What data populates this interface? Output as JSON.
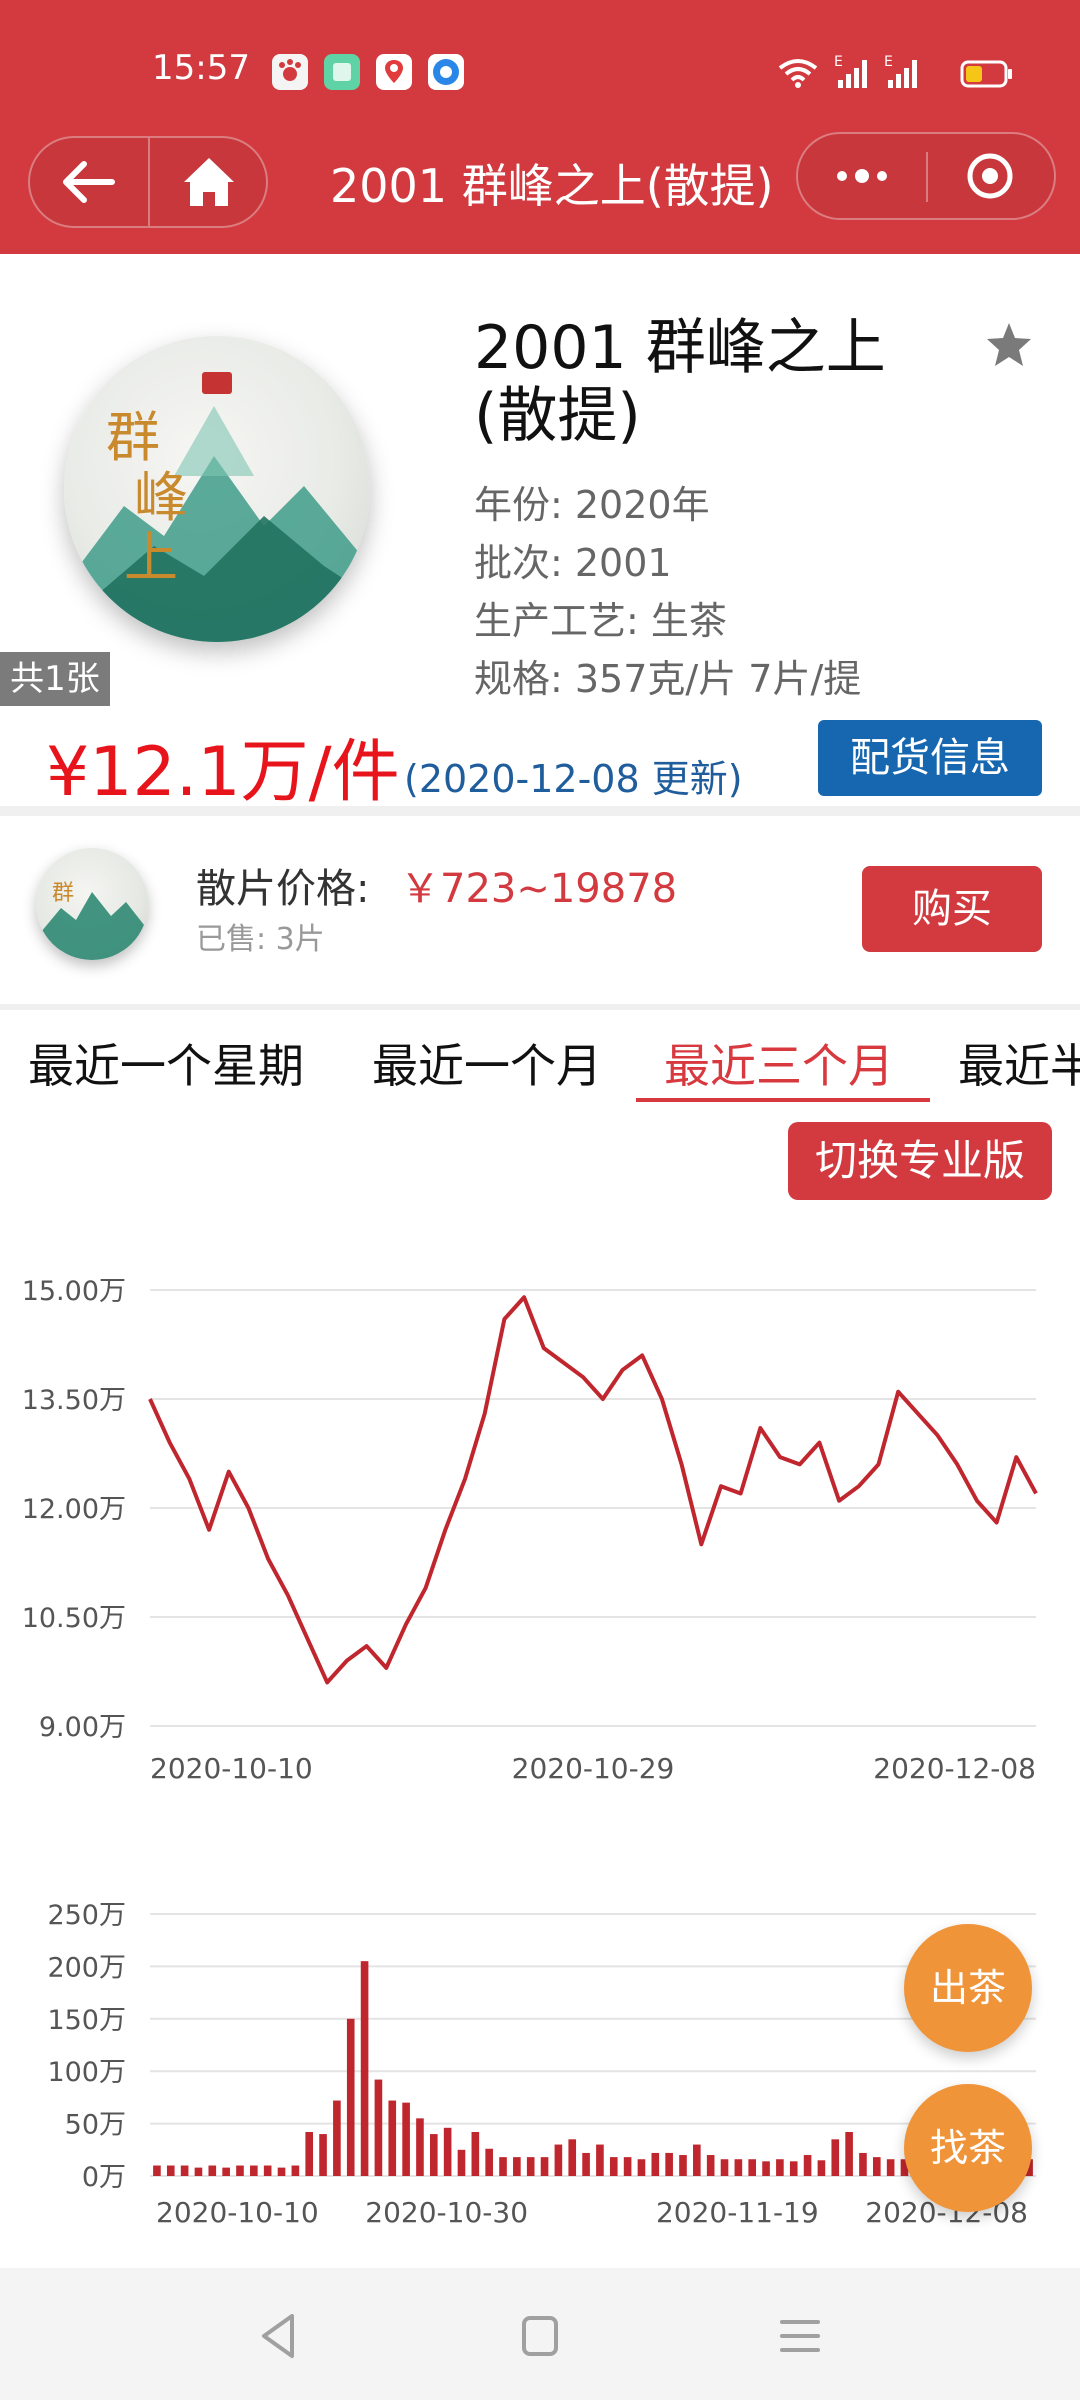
{
  "status_bar": {
    "time": "15:57",
    "app_icons": [
      "paw-app-icon",
      "green-app-icon",
      "map-app-icon",
      "blue-app-icon"
    ],
    "signal_labels": [
      "E",
      "E"
    ]
  },
  "nav": {
    "title": "2001 群峰之上(散提)"
  },
  "product": {
    "title": "2001 群峰之上(散提)",
    "image_count": "共1张",
    "year": "年份: 2020年",
    "batch": "批次: 2001",
    "process": "生产工艺: 生茶",
    "spec": "规格: 357克/片 7片/提",
    "price": "¥12.1万/件",
    "updated": "(2020-12-08 更新)",
    "allocation_button": "配货信息"
  },
  "loose": {
    "label": "散片价格:",
    "price": "￥723~19878",
    "sold": "已售: 3片",
    "buy_button": "购买"
  },
  "tabs": [
    "最近一个星期",
    "最近一个月",
    "最近三个月",
    "最近半"
  ],
  "active_tab": 2,
  "pro_button": "切换专业版",
  "fabs": {
    "sell": "出茶",
    "find": "找茶"
  },
  "colors": {
    "brand_red": "#d23a3f",
    "price_red": "#e8141b",
    "link_blue": "#1767b0",
    "orange": "#f0943a",
    "line": "#c0262d"
  },
  "chart_data": [
    {
      "type": "line",
      "y_tick_labels": [
        "15.00万",
        "13.50万",
        "12.00万",
        "10.50万",
        "9.00万"
      ],
      "x_tick_labels": [
        "2020-10-10",
        "2020-10-29",
        "2020-12-08"
      ],
      "ylim": [
        9.0,
        15.0
      ],
      "unit": "万",
      "grid": true,
      "values": [
        13.5,
        12.9,
        12.4,
        11.7,
        12.5,
        12.0,
        11.3,
        10.8,
        10.2,
        9.6,
        9.9,
        10.1,
        9.8,
        10.4,
        10.9,
        11.7,
        12.4,
        13.3,
        14.6,
        14.9,
        14.2,
        14.0,
        13.8,
        13.5,
        13.9,
        14.1,
        13.5,
        12.6,
        11.5,
        12.3,
        12.2,
        13.1,
        12.7,
        12.6,
        12.9,
        12.1,
        12.3,
        12.6,
        13.6,
        13.3,
        13.0,
        12.6,
        12.1,
        11.8,
        12.7,
        12.2
      ]
    },
    {
      "type": "bar",
      "y_tick_labels": [
        "250万",
        "200万",
        "150万",
        "100万",
        "50万",
        "0万"
      ],
      "x_tick_labels": [
        "2020-10-10",
        "2020-10-30",
        "2020-11-19",
        "2020-12-08"
      ],
      "ylim": [
        0,
        250
      ],
      "unit": "万",
      "grid": true,
      "values": [
        10,
        10,
        10,
        8,
        10,
        8,
        10,
        10,
        10,
        8,
        10,
        42,
        40,
        72,
        150,
        205,
        92,
        72,
        70,
        55,
        40,
        46,
        25,
        42,
        26,
        18,
        18,
        18,
        18,
        30,
        35,
        22,
        30,
        18,
        18,
        16,
        22,
        22,
        20,
        30,
        20,
        16,
        16,
        16,
        14,
        16,
        14,
        20,
        15,
        35,
        42,
        22,
        18,
        16,
        16,
        14,
        14,
        16,
        25,
        22,
        20,
        24,
        18,
        16
      ]
    }
  ]
}
